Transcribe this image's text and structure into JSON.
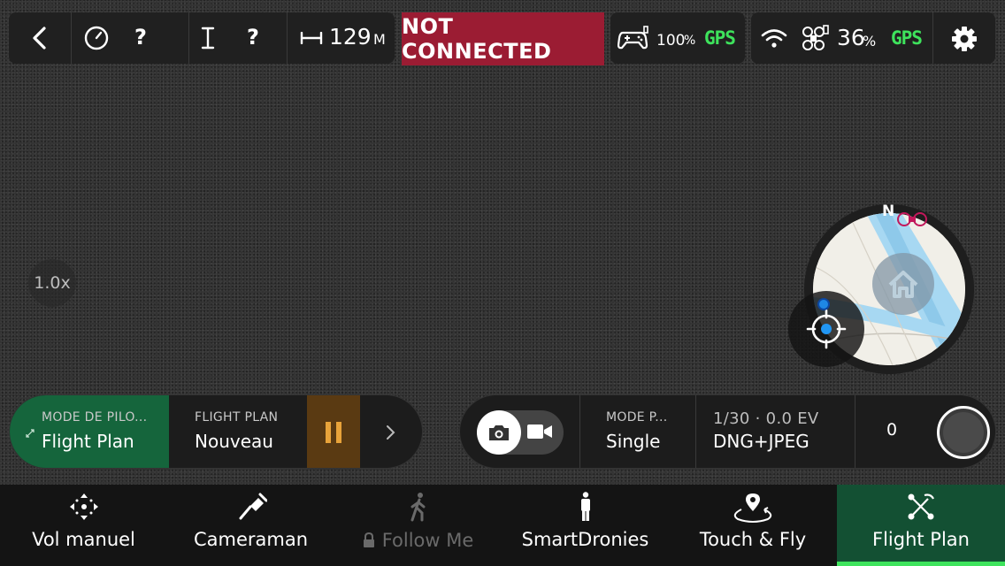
{
  "top_bar": {
    "question_1": "?",
    "question_2": "?",
    "distance_value": "129",
    "distance_unit": "M",
    "connection_status": "NOT CONNECTED",
    "controller_battery": "100",
    "controller_battery_unit": "%",
    "controller_gps": "GPS",
    "drone_battery": "36",
    "drone_battery_unit": "%",
    "drone_gps": "GPS",
    "icons": [
      "back-icon",
      "speed-gauge-icon",
      "height-icon",
      "distance-icon",
      "controller-icon",
      "wifi-icon",
      "drone-icon",
      "settings-gear-icon"
    ]
  },
  "zoom": {
    "label": "1.0x"
  },
  "minimap": {
    "north_label": "N"
  },
  "flight_panel": {
    "mode_label": "MODE DE PILO...",
    "mode_value": "Flight Plan",
    "plan_label": "FLIGHT PLAN",
    "plan_value": "Nouveau"
  },
  "camera_panel": {
    "mode_label": "MODE P...",
    "mode_value": "Single",
    "exposure": "1/30 · 0.0 EV",
    "format": "DNG+JPEG",
    "count": "0"
  },
  "bottom_nav": {
    "items": [
      {
        "label": "Vol manuel",
        "icon": "move-arrows-icon"
      },
      {
        "label": "Cameraman",
        "icon": "cameraman-icon"
      },
      {
        "label": "Follow Me",
        "icon": "walking-person-icon",
        "locked": true
      },
      {
        "label": "SmartDronies",
        "icon": "standing-person-icon"
      },
      {
        "label": "Touch & Fly",
        "icon": "map-pin-icon"
      },
      {
        "label": "Flight Plan",
        "icon": "flight-plan-icon",
        "active": true
      }
    ]
  },
  "colors": {
    "status_red": "#9b1c33",
    "gps_green": "#3ee35c",
    "active_green": "#15653c",
    "pause_brown": "#5a3a12",
    "map_water": "#a7d8f2"
  }
}
